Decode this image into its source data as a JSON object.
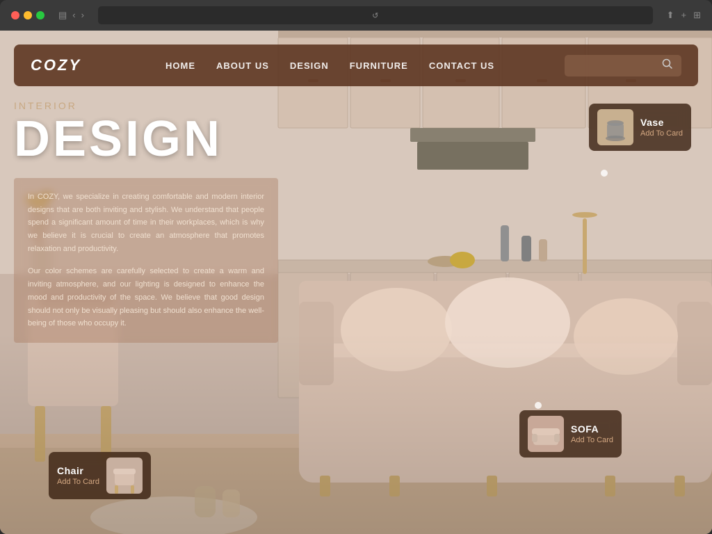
{
  "browser": {
    "dots": [
      "red",
      "yellow",
      "green"
    ],
    "back_icon": "‹",
    "forward_icon": "›",
    "share_icon": "⬆",
    "plus_icon": "+",
    "grid_icon": "⊞",
    "sidebar_icon": "▤",
    "refresh_icon": "↺"
  },
  "navbar": {
    "logo": "COZY",
    "links": [
      {
        "label": "HOME",
        "id": "home"
      },
      {
        "label": "ABOUT US",
        "id": "about"
      },
      {
        "label": "DESIGN",
        "id": "design"
      },
      {
        "label": "FURNITURE",
        "id": "furniture"
      },
      {
        "label": "CONTACT US",
        "id": "contact"
      }
    ],
    "search_placeholder": ""
  },
  "hero": {
    "subtitle": "INTERIOR",
    "title": "DESIGN",
    "description1": "In COZY, we specialize in creating comfortable and modern interior designs that are both inviting and stylish. We understand that people spend a significant amount of time in their workplaces, which is why we believe it is crucial to create an atmosphere that promotes relaxation and productivity.",
    "description2": "Our color schemes are carefully selected to create a warm and inviting atmosphere, and our lighting is designed to enhance the mood and productivity of the space. We believe that good design should not only be visually pleasing but should also enhance the well-being of those who occupy it."
  },
  "products": {
    "vase": {
      "name": "Vase",
      "cta": "Add To Card"
    },
    "sofa": {
      "name": "SOFA",
      "cta": "Add To Card"
    },
    "chair": {
      "name": "Chair",
      "cta": "Add To Card"
    }
  },
  "colors": {
    "navbar_bg": "rgba(90, 50, 30, 0.88)",
    "card_bg": "rgba(60, 35, 20, 0.82)",
    "accent": "#d4a882",
    "hero_title": "#ffffff",
    "subtitle": "#c8a882"
  }
}
